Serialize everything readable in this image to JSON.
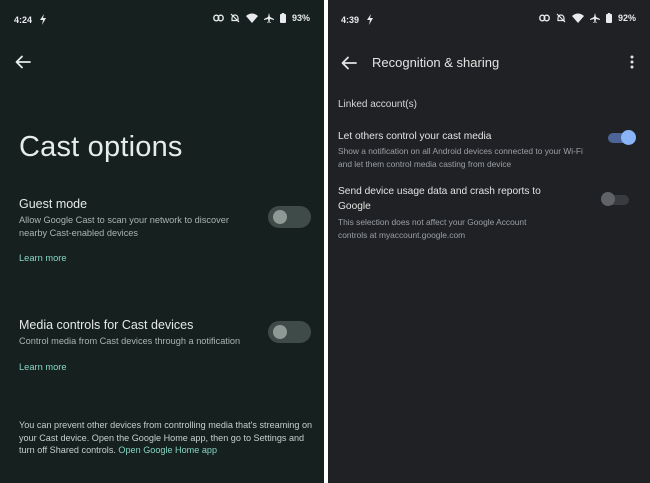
{
  "left": {
    "status": {
      "time": "4:24",
      "battery": "93%"
    },
    "title": "Cast options",
    "guest_mode": {
      "title": "Guest mode",
      "description": "Allow Google Cast to scan your network to discover nearby Cast-enabled devices",
      "learn_more": "Learn more",
      "enabled": false
    },
    "media_controls": {
      "title": "Media controls for Cast devices",
      "description": "Control media from Cast devices through a notification",
      "learn_more": "Learn more",
      "enabled": false
    },
    "footer": {
      "text": "You can prevent other devices from controlling media that's streaming on your Cast device. Open the Google Home app, then go to Settings and turn off Shared controls.",
      "link": "Open Google Home app"
    }
  },
  "right": {
    "status": {
      "time": "4:39",
      "battery": "92%"
    },
    "title": "Recognition & sharing",
    "section": "Linked account(s)",
    "let_others": {
      "title": "Let others control your cast media",
      "description": "Show a notification on all Android devices connected to your Wi-Fi and let them control media casting from device",
      "enabled": true
    },
    "usage_data": {
      "title": "Send device usage data and crash reports to Google",
      "description": "This selection does not affect your Google Account controls at myaccount.google.com",
      "enabled": false
    }
  },
  "colors": {
    "left_bg": "#16201f",
    "right_bg": "#202124",
    "accent_teal": "#86d5c4",
    "accent_blue": "#8ab4f8"
  }
}
